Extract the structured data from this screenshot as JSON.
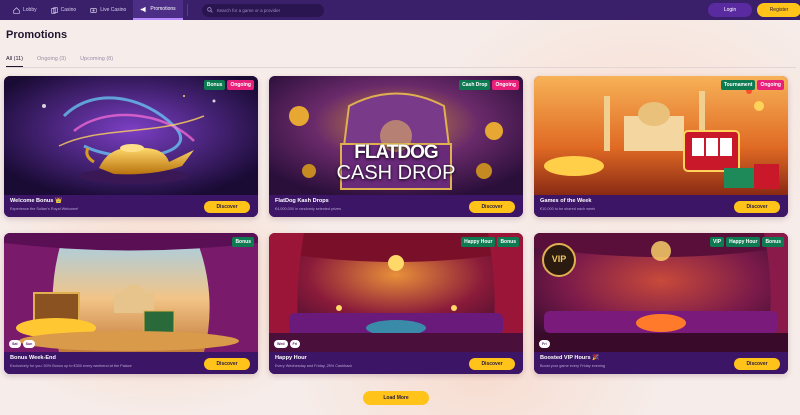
{
  "nav": {
    "items": [
      {
        "label": "Lobby",
        "icon": "home-icon"
      },
      {
        "label": "Casino",
        "icon": "cards-icon"
      },
      {
        "label": "Live Casino",
        "icon": "live-icon"
      },
      {
        "label": "Promotions",
        "icon": "megaphone-icon"
      }
    ],
    "search_placeholder": "Search for a game or a provider",
    "login": "Login",
    "register": "Register"
  },
  "page": {
    "title": "Promotions",
    "tabs": [
      {
        "label": "All (11)"
      },
      {
        "label": "Ongoing (3)"
      },
      {
        "label": "Upcoming (8)"
      }
    ],
    "load_more": "Load More"
  },
  "cards": [
    {
      "title": "Welcome Bonus 👑",
      "subtitle": "Experience the Sultan's Royal Welcome!",
      "badges": [
        "Bonus",
        "Ongoing"
      ],
      "button": "Discover"
    },
    {
      "title": "FlatDog Kash Drops",
      "subtitle": "€4,000,000 in randomly selected prizes",
      "badges": [
        "Cash Drop",
        "Ongoing"
      ],
      "button": "Discover",
      "art_text_1": "FLATDOG",
      "art_text_2": "CASH DROP"
    },
    {
      "title": "Games of the Week",
      "subtitle": "€10,000 to be shared each week",
      "badges": [
        "Tournament",
        "Ongoing"
      ],
      "button": "Discover"
    },
    {
      "title": "Bonus Week-End",
      "subtitle": "Exclusively for you: 50% Bonus up to €300 every weekend at the Palace",
      "badges": [
        "Bonus"
      ],
      "mini": [
        "Sat",
        "Sun"
      ],
      "button": "Discover"
    },
    {
      "title": "Happy Hour",
      "subtitle": "Every Wednesday and Friday, 25% Cashback",
      "badges": [
        "Happy Hour",
        "Bonus"
      ],
      "mini": [
        "Wed",
        "Fri"
      ],
      "button": "Discover"
    },
    {
      "title": "Boosted VIP Hours 🎉",
      "subtitle": "Boost your game every Friday evening",
      "badges": [
        "VIP",
        "Happy Hour",
        "Bonus"
      ],
      "mini": [
        "Fri"
      ],
      "button": "Discover",
      "art_text_1": "VIP"
    }
  ],
  "colors": {
    "accent": "#ffc31a",
    "nav_bg": "#3a1f6a",
    "card_footer": "#3c1566",
    "badge_green": "#0d7a52",
    "badge_pink": "#e8207a"
  }
}
